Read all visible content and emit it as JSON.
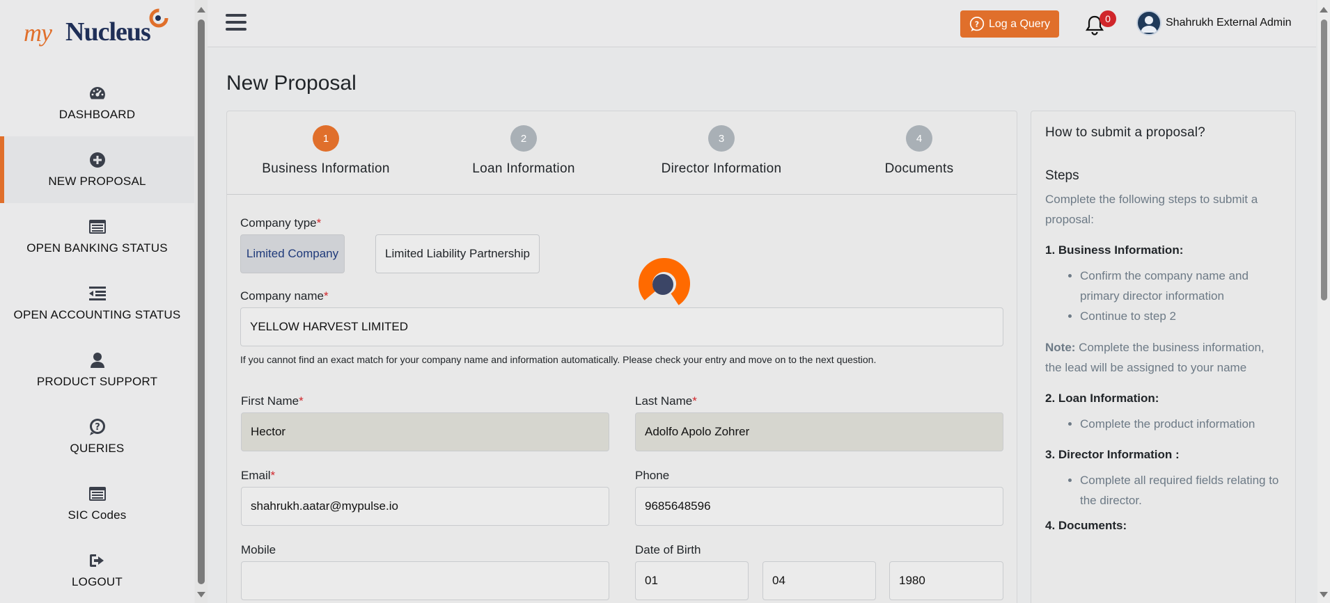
{
  "logo": {
    "my": "my",
    "nucleus": "Nucleus"
  },
  "sidebar": {
    "items": [
      {
        "label": "DASHBOARD",
        "icon": "dashboard-icon"
      },
      {
        "label": "NEW PROPOSAL",
        "icon": "plus-circle-icon",
        "active": true
      },
      {
        "label": "OPEN BANKING STATUS",
        "icon": "banking-card-icon"
      },
      {
        "label": "OPEN ACCOUNTING STATUS",
        "icon": "list-indent-icon"
      },
      {
        "label": "PRODUCT SUPPORT",
        "icon": "user-icon"
      },
      {
        "label": "QUERIES",
        "icon": "question-bubble-icon"
      },
      {
        "label": "SIC Codes",
        "icon": "banking-card-icon"
      },
      {
        "label": "LOGOUT",
        "icon": "logout-icon"
      }
    ]
  },
  "topbar": {
    "query_button": "Log a Query",
    "notification_count": "0",
    "user_name": "Shahrukh External Admin"
  },
  "page": {
    "title": "New Proposal"
  },
  "steps": [
    {
      "num": "1",
      "label": "Business Information",
      "active": true
    },
    {
      "num": "2",
      "label": "Loan Information"
    },
    {
      "num": "3",
      "label": "Director Information"
    },
    {
      "num": "4",
      "label": "Documents"
    }
  ],
  "form": {
    "company_type_label": "Company type",
    "company_types": [
      "Limited Company",
      "Limited Liability Partnership"
    ],
    "company_type_selected": "Limited Company",
    "company_name_label": "Company name",
    "company_name": "YELLOW HARVEST LIMITED",
    "help_text": "If you cannot find an exact match for your company name and information automatically. Please check your entry and move on to the next question.",
    "first_name_label": "First Name",
    "first_name": "Hector",
    "last_name_label": "Last Name",
    "last_name": "Adolfo Apolo Zohrer",
    "email_label": "Email",
    "email": "shahrukh.aatar@mypulse.io",
    "phone_label": "Phone",
    "phone": "9685648596",
    "mobile_label": "Mobile",
    "mobile": "",
    "dob_label": "Date of Birth",
    "dob_day": "01",
    "dob_month": "04",
    "dob_year": "1980",
    "required_mark": "*"
  },
  "howto": {
    "title": "How to submit a proposal?",
    "steps_heading": "Steps",
    "intro": "Complete the following steps to submit a proposal:",
    "s1_title": "1. Business Information:",
    "s1_items": [
      "Confirm the company name and primary director information",
      "Continue to step 2"
    ],
    "note_label": "Note:",
    "note_text": " Complete the business information, the lead will be assigned to your name",
    "s2_title": "2. Loan Information:",
    "s2_items": [
      "Complete the product information"
    ],
    "s3_title": "3. Director Information :",
    "s3_items": [
      "Complete all required fields relating to the director."
    ],
    "s4_title": "4. Documents:"
  },
  "colors": {
    "accent": "#e06f2b",
    "navy": "#1f2f57",
    "badge": "#d0262b"
  }
}
